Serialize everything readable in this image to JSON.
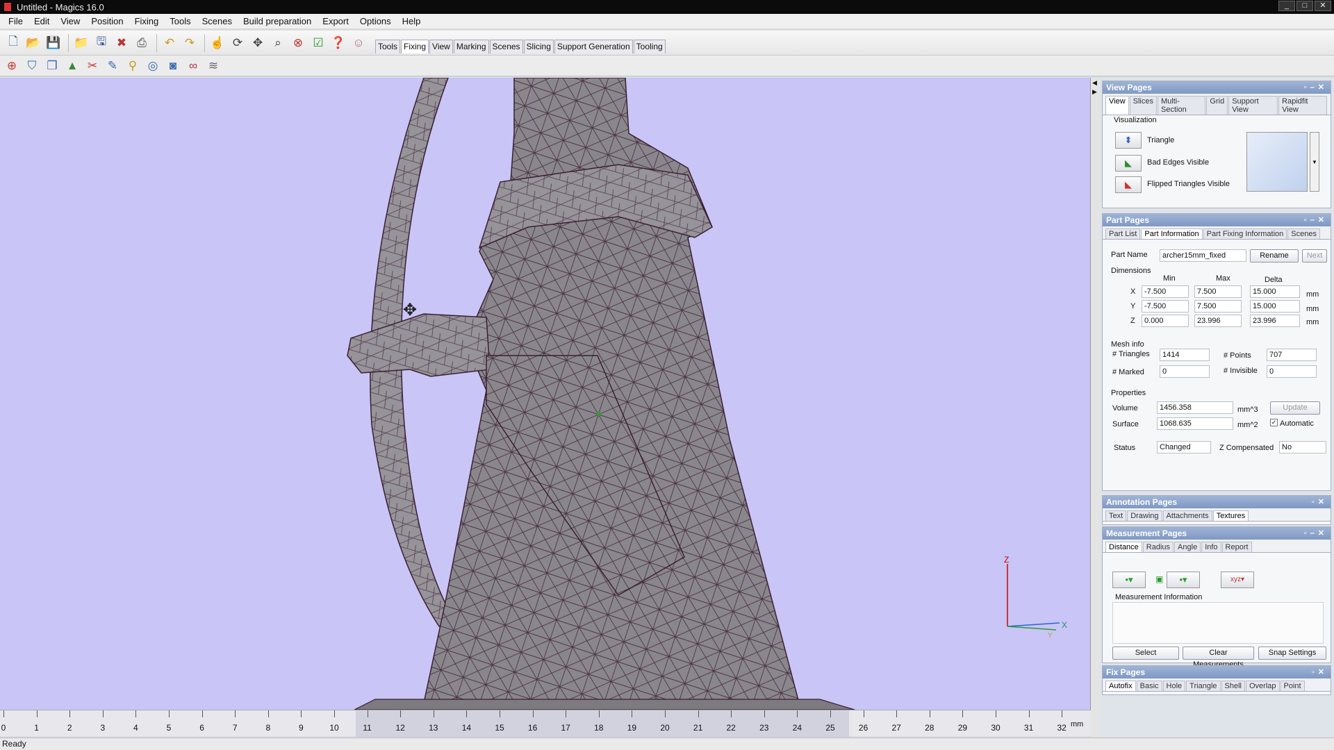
{
  "window": {
    "title": "Untitled - Magics 16.0",
    "controls": [
      "_",
      "□",
      "✕"
    ]
  },
  "menu": [
    "File",
    "Edit",
    "View",
    "Position",
    "Fixing",
    "Tools",
    "Scenes",
    "Build preparation",
    "Export",
    "Options",
    "Help"
  ],
  "toolbar_tabs": [
    {
      "label": "Tools",
      "active": false
    },
    {
      "label": "Fixing",
      "active": true
    },
    {
      "label": "View",
      "active": false
    },
    {
      "label": "Marking",
      "active": false
    },
    {
      "label": "Scenes",
      "active": false
    },
    {
      "label": "Slicing",
      "active": false
    },
    {
      "label": "Support Generation",
      "active": false
    },
    {
      "label": "Tooling",
      "active": false
    }
  ],
  "viewport": {
    "background": "#c9c5f6",
    "mesh_color": "#8a878c",
    "edge_color": "#3a1f33",
    "axis": {
      "z": "Z",
      "x": "X",
      "y": "Y"
    }
  },
  "ruler": {
    "labels": [
      "0",
      "1",
      "2",
      "3",
      "4",
      "5",
      "6",
      "7",
      "8",
      "9",
      "10",
      "11",
      "12",
      "13",
      "14",
      "15",
      "16",
      "17",
      "18",
      "19",
      "20",
      "21",
      "22",
      "23",
      "24",
      "25",
      "26",
      "27",
      "28",
      "29",
      "30",
      "31",
      "32"
    ],
    "unit": "mm"
  },
  "status": "Ready",
  "view_pages": {
    "title": "View Pages",
    "tabs": [
      "View",
      "Slices",
      "Multi-Section",
      "Grid",
      "Support View",
      "Rapidfit View"
    ],
    "active_tab": "View",
    "section": "Visualization",
    "items": [
      "Triangle",
      "Bad Edges Visible",
      "Flipped Triangles Visible"
    ]
  },
  "part_pages": {
    "title": "Part Pages",
    "tabs": [
      "Part List",
      "Part Information",
      "Part Fixing Information",
      "Scenes"
    ],
    "active_tab": "Part Information",
    "part_name_label": "Part Name",
    "part_name": "archer15mm_fixed",
    "rename": "Rename",
    "next": "Next",
    "dimensions_label": "Dimensions",
    "col_min": "Min",
    "col_max": "Max",
    "col_delta": "Delta",
    "rows": [
      {
        "axis": "X",
        "min": "-7.500",
        "max": "7.500",
        "delta": "15.000",
        "unit": "mm"
      },
      {
        "axis": "Y",
        "min": "-7.500",
        "max": "7.500",
        "delta": "15.000",
        "unit": "mm"
      },
      {
        "axis": "Z",
        "min": "0.000",
        "max": "23.996",
        "delta": "23.996",
        "unit": "mm"
      }
    ],
    "mesh_info_label": "Mesh info",
    "triangles_label": "# Triangles",
    "triangles": "1414",
    "points_label": "# Points",
    "points": "707",
    "marked_label": "# Marked",
    "marked": "0",
    "invisible_label": "# Invisible",
    "invisible": "0",
    "properties_label": "Properties",
    "volume_label": "Volume",
    "volume": "1456.358",
    "volume_unit": "mm^3",
    "surface_label": "Surface",
    "surface": "1068.635",
    "surface_unit": "mm^2",
    "update": "Update",
    "automatic": "Automatic",
    "status_label": "Status",
    "status": "Changed",
    "zcomp_label": "Z Compensated",
    "zcomp": "No"
  },
  "annotation_pages": {
    "title": "Annotation Pages",
    "tabs": [
      "Text",
      "Drawing",
      "Attachments",
      "Textures"
    ],
    "active_tab": "Textures"
  },
  "measurement_pages": {
    "title": "Measurement Pages",
    "tabs": [
      "Distance",
      "Radius",
      "Angle",
      "Info",
      "Report"
    ],
    "active_tab": "Distance",
    "info_label": "Measurement Information",
    "select": "Select",
    "clear": "Clear Measurements",
    "snap": "Snap Settings"
  },
  "fix_pages": {
    "title": "Fix Pages",
    "tabs": [
      "Autofix",
      "Basic",
      "Hole",
      "Triangle",
      "Shell",
      "Overlap",
      "Point"
    ],
    "active_tab": "Autofix"
  }
}
